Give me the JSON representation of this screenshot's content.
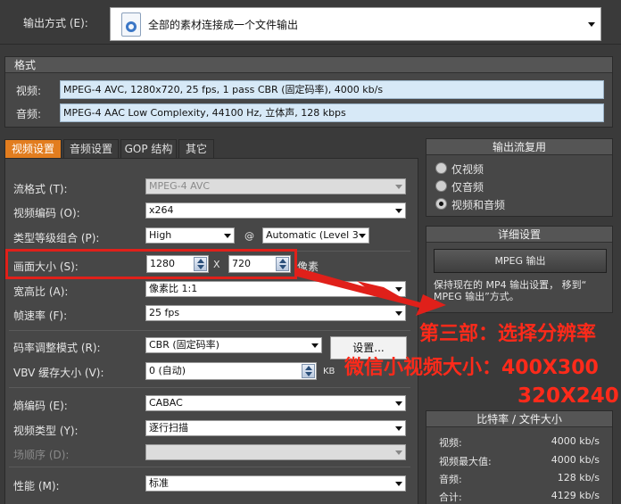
{
  "output_mode": {
    "label": "输出方式 (E):",
    "value": "全部的素材连接成一个文件输出"
  },
  "format": {
    "header": "格式",
    "video_label": "视频:",
    "video_value": "MPEG-4 AVC, 1280x720, 25 fps, 1 pass CBR (固定码率), 4000 kb/s",
    "audio_label": "音频:",
    "audio_value": "MPEG-4 AAC Low Complexity, 44100 Hz, 立体声, 128 kbps"
  },
  "tabs": [
    {
      "label": "视频设置"
    },
    {
      "label": "音频设置"
    },
    {
      "label": "GOP 结构"
    },
    {
      "label": "其它"
    }
  ],
  "video_settings": {
    "stream_format_label": "流格式 (T):",
    "stream_format_value": "MPEG-4 AVC",
    "codec_label": "视频编码 (O):",
    "codec_value": "x264",
    "profile_label": "类型等级组合 (P):",
    "profile_value": "High",
    "at_sign": "@",
    "level_value": "Automatic (Level 3",
    "frame_size_label": "画面大小 (S):",
    "width_value": "1280",
    "x_sep": "X",
    "height_value": "720",
    "pixel_unit": "像素",
    "aspect_label": "宽高比 (A):",
    "aspect_value": "像素比 1:1",
    "framerate_label": "帧速率 (F):",
    "framerate_value": "25 fps",
    "bitrate_mode_label": "码率调整模式 (R):",
    "bitrate_mode_value": "CBR (固定码率)",
    "settings_button": "设置...",
    "vbv_label": "VBV 缓存大小 (V):",
    "vbv_value": "0 (自动)",
    "vbv_unit": "KB",
    "entropy_label": "熵编码 (E):",
    "entropy_value": "CABAC",
    "video_type_label": "视频类型 (Y):",
    "video_type_value": "逐行扫描",
    "field_order_label": "场顺序 (D):",
    "field_order_value": "",
    "performance_label": "性能 (M):",
    "performance_value": "标准"
  },
  "output_stream": {
    "header": "输出流复用",
    "options": [
      {
        "label": "仅视频",
        "selected": false
      },
      {
        "label": "仅音频",
        "selected": false
      },
      {
        "label": "视频和音频",
        "selected": true
      }
    ]
  },
  "details": {
    "header": "详细设置",
    "button": "MPEG 输出",
    "note": "保持现在的 MP4 输出设置， 移到“ MPEG 输出”方式。"
  },
  "bitrate_summary": {
    "header": "比特率 / 文件大小",
    "rows": [
      {
        "label": "视频:",
        "value": "4000 kb/s"
      },
      {
        "label": "视频最大值:",
        "value": "4000 kb/s"
      },
      {
        "label": "音频:",
        "value": "128 kb/s"
      },
      {
        "label": "合计:",
        "value": "4129 kb/s"
      }
    ]
  },
  "annotation": {
    "line1": "第三部：选择分辨率",
    "line2": "微信小视频大小：400X300",
    "line3": "320X240",
    "color": "#ff2a1a",
    "highlight_color": "#e0201a"
  }
}
